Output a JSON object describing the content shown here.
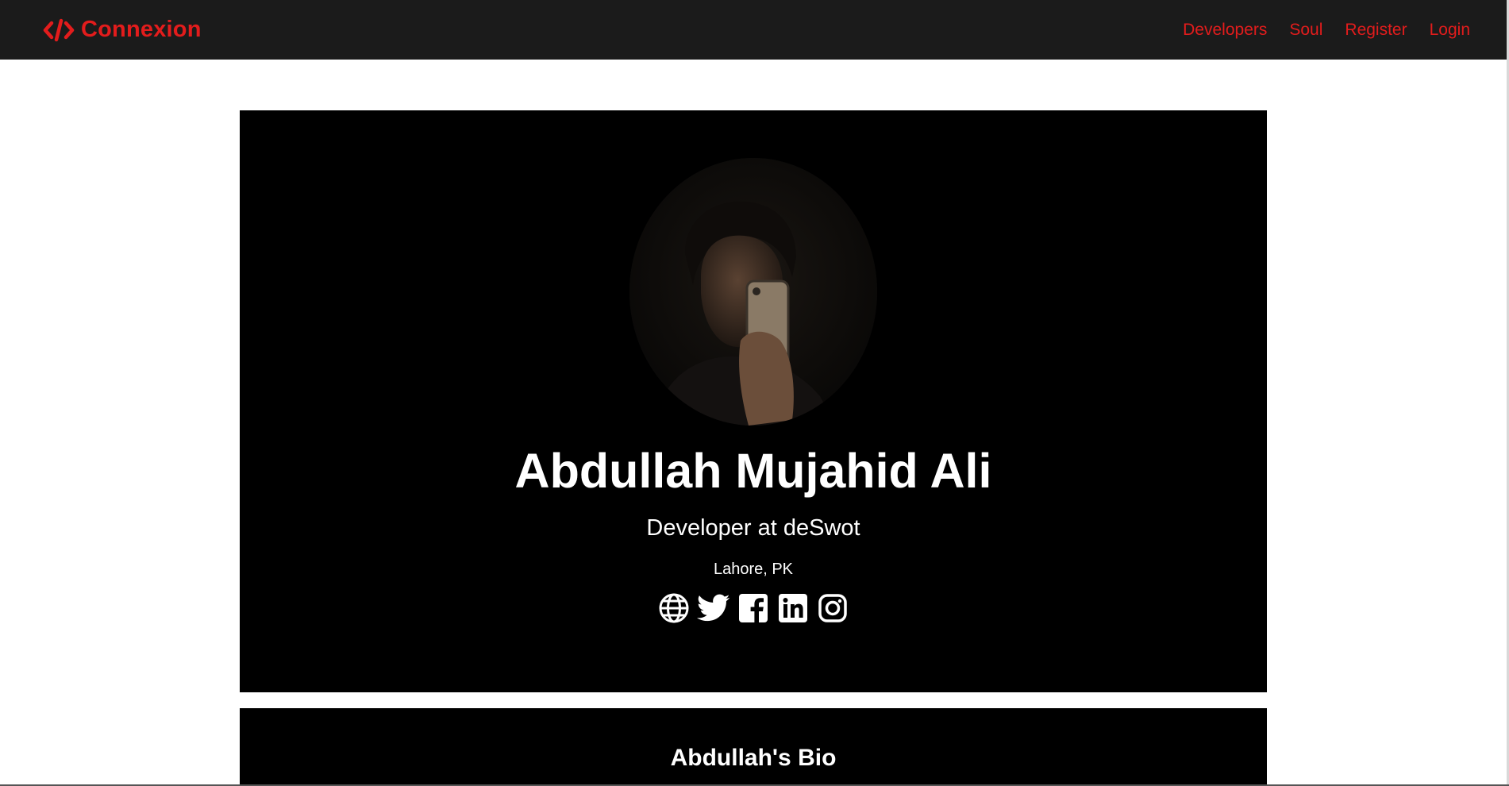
{
  "navbar": {
    "brand_icon": "code-icon",
    "brand_name": "Connexion",
    "links": [
      {
        "label": "Developers"
      },
      {
        "label": "Soul"
      },
      {
        "label": "Register"
      },
      {
        "label": "Login"
      }
    ],
    "accent_color": "#e31c1c",
    "background": "#1b1b1b"
  },
  "profile": {
    "name": "Abdullah Mujahid Ali",
    "status": "Developer at deSwot",
    "location": "Lahore, PK",
    "avatar_icon": "profile-photo",
    "socials": [
      {
        "icon": "globe-icon"
      },
      {
        "icon": "twitter-icon"
      },
      {
        "icon": "facebook-icon"
      },
      {
        "icon": "linkedin-icon"
      },
      {
        "icon": "instagram-icon"
      }
    ]
  },
  "bio": {
    "heading": "Abdullah's Bio"
  }
}
